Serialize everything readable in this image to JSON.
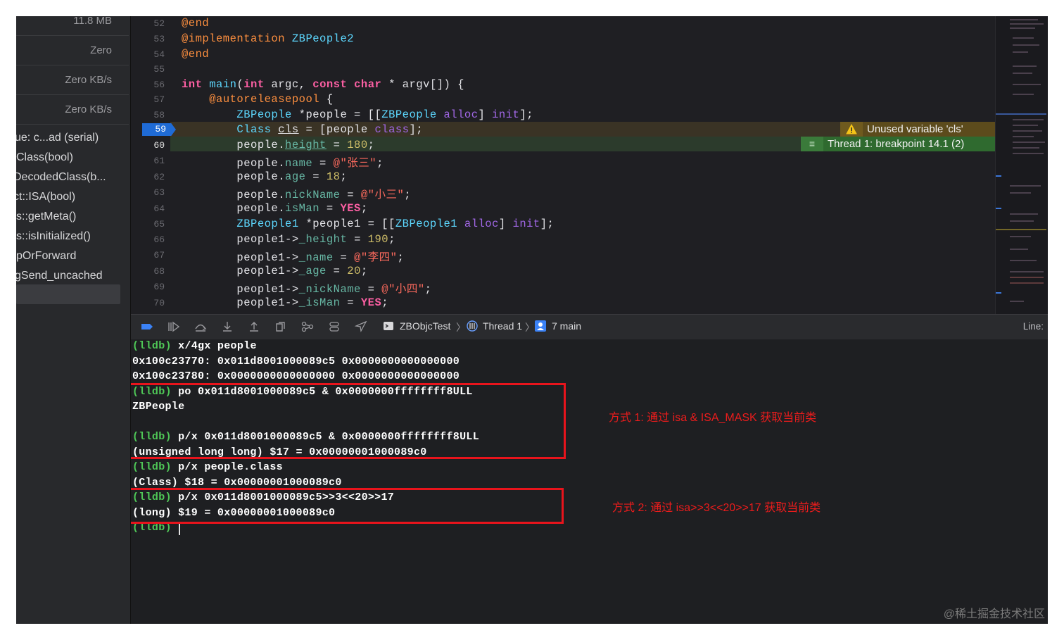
{
  "sidebar": {
    "gauges": [
      "11.8 MB",
      "Zero",
      "Zero KB/s",
      "Zero KB/s"
    ],
    "frames": [
      "ue: c...ad (serial)",
      "Class(bool)",
      "DecodedClass(b...",
      "ct::ISA(bool)",
      "s::getMeta()",
      "s::isInitialized()",
      "pOrForward",
      "gSend_uncached"
    ]
  },
  "editor": {
    "line_numbers": [
      "52",
      "53",
      "54",
      "55",
      "56",
      "57",
      "58",
      "59",
      "60",
      "61",
      "62",
      "63",
      "64",
      "65",
      "66",
      "67",
      "68",
      "69",
      "70"
    ],
    "current_line": "59",
    "warning": "Unused variable 'cls'",
    "breakpoint_label": "Thread 1: breakpoint 14.1 (2)"
  },
  "debugbar": {
    "target": "ZBObjcTest",
    "thread": "Thread 1",
    "frame": "7 main",
    "line_label": "Line:"
  },
  "console": {
    "lines": [
      {
        "prompt": "(lldb) ",
        "text": "x/4gx people"
      },
      {
        "prompt": "",
        "text": "0x100c23770: 0x011d8001000089c5 0x0000000000000000"
      },
      {
        "prompt": "",
        "text": "0x100c23780: 0x0000000000000000 0x0000000000000000"
      },
      {
        "prompt": "(lldb) ",
        "text": "po 0x011d8001000089c5 & 0x0000000ffffffff8ULL"
      },
      {
        "prompt": "",
        "text": "ZBPeople"
      },
      {
        "prompt": "",
        "text": ""
      },
      {
        "prompt": "(lldb) ",
        "text": "p/x 0x011d8001000089c5 & 0x0000000ffffffff8ULL"
      },
      {
        "prompt": "",
        "text": "(unsigned long long) $17 = 0x00000001000089c0"
      },
      {
        "prompt": "(lldb) ",
        "text": "p/x people.class"
      },
      {
        "prompt": "",
        "text": "(Class) $18 = 0x00000001000089c0"
      },
      {
        "prompt": "(lldb) ",
        "text": "p/x 0x011d8001000089c5>>3<<20>>17"
      },
      {
        "prompt": "",
        "text": "(long) $19 = 0x00000001000089c0"
      },
      {
        "prompt": "(lldb) ",
        "text": ""
      }
    ]
  },
  "annotations": {
    "method1": "方式 1:   通过 isa & ISA_MASK 获取当前类",
    "method2": "方式 2:   通过 isa>>3<<20>>17 获取当前类"
  },
  "watermark": "@稀土掘金技术社区",
  "colors": {
    "breakpoint_blue": "#1f6bd6",
    "prompt_green": "#4fc857",
    "annotation_red": "#e8141c"
  }
}
